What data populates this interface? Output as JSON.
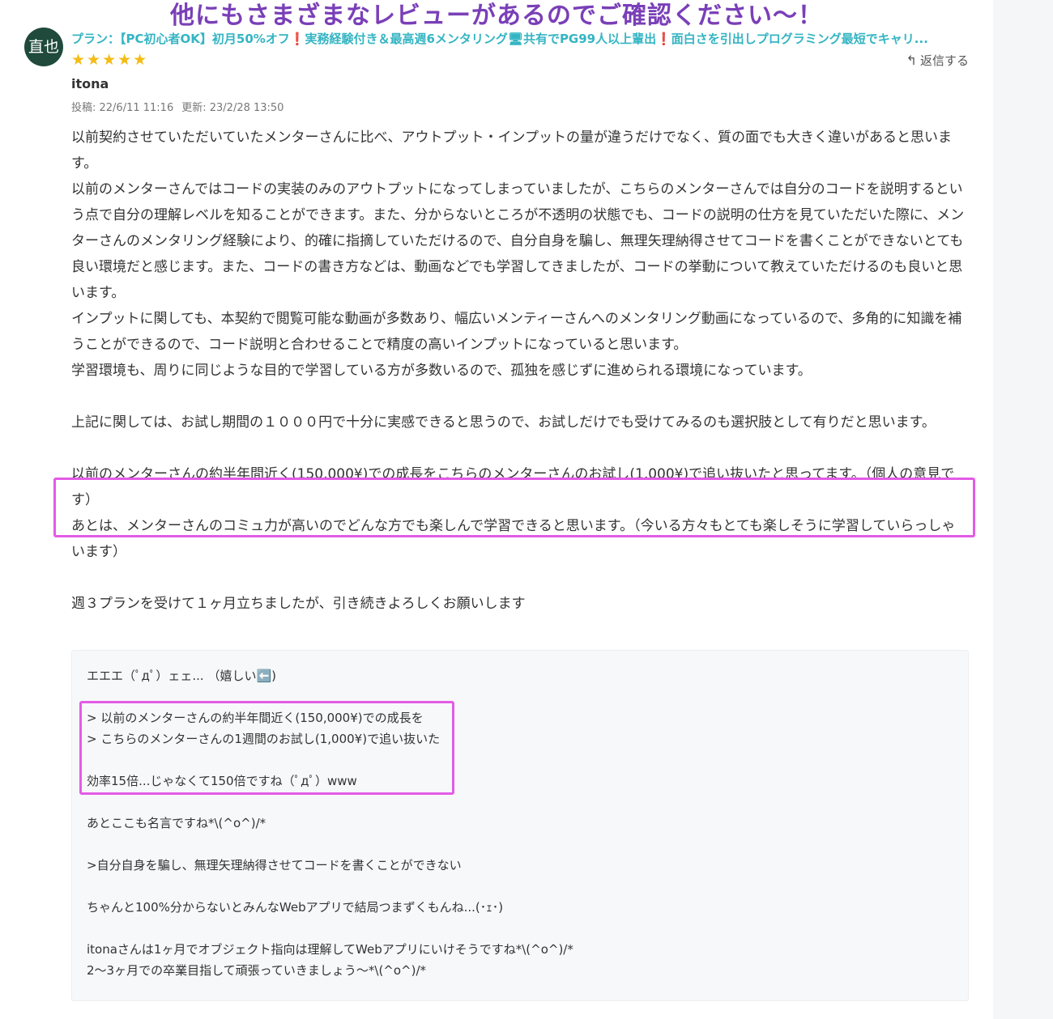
{
  "banner": "他にもさまざまなレビューがあるのでご確認ください〜！",
  "avatar": "直也",
  "plan": "プラン：【PC初心者OK】初月50%オフ❗️実務経験付き＆最高週6メンタリング🖥共有でPG99人以上輩出❗️面白さを引出しプログラミング最短でキャリ...",
  "stars": "★★★★★",
  "reply_label": "返信する",
  "user": "itona",
  "posted": "投稿: 22/6/11 11:16",
  "updated": "更新: 23/2/28 13:50",
  "review": [
    "以前契約させていただいていたメンターさんに比べ、アウトプット・インプットの量が違うだけでなく、質の面でも大きく違いがあると思います。",
    "以前のメンターさんではコードの実装のみのアウトプットになってしまっていましたが、こちらのメンターさんでは自分のコードを説明するという点で自分の理解レベルを知ることができます。また、分からないところが不透明の状態でも、コードの説明の仕方を見ていただいた際に、メンターさんのメンタリング経験により、的確に指摘していただけるので、自分自身を騙し、無理矢理納得させてコードを書くことができないとても良い環境だと感じます。また、コードの書き方などは、動画などでも学習してきましたが、コードの挙動について教えていただけるのも良いと思います。",
    "インプットに関しても、本契約で閲覧可能な動画が多数あり、幅広いメンティーさんへのメンタリング動画になっているので、多角的に知識を補うことができるので、コード説明と合わせることで精度の高いインプットになっていると思います。",
    "学習環境も、周りに同じような目的で学習している方が多数いるので、孤独を感じずに進められる環境になっています。",
    "",
    "上記に関しては、お試し期間の１０００円で十分に実感できると思うので、お試しだけでも受けてみるのも選択肢として有りだと思います。",
    "",
    "以前のメンターさんの約半年間近く(150,000¥)での成長をこちらのメンターさんのお試し(1,000¥)で追い抜いたと思ってます。（個人の意見です）",
    "あとは、メンターさんのコミュ力が高いのでどんな方でも楽しんで学習できると思います。（今いる方々もとても楽しそうに学習していらっしゃいます）",
    "",
    "週３プランを受けて１ヶ月立ちましたが、引き続きよろしくお願いします"
  ],
  "mentor_reply": [
    "エエエ（ﾟдﾟ）ェェ... （嬉しい⬅️)",
    "",
    "> 以前のメンターさんの約半年間近く(150,000¥)での成長を",
    "> こちらのメンターさんの1週間のお試し(1,000¥)で追い抜いた",
    "",
    "効率15倍...じゃなくて150倍ですね（ﾟдﾟ）www",
    "",
    "あとここも名言ですね*\\(^o^)/*",
    "",
    ">自分自身を騙し、無理矢理納得させてコードを書くことができない",
    "",
    "ちゃんと100%分からないとみんなWebアプリで結局つまずくもんね...(･ｪ･)",
    "",
    "itonaさんは1ヶ月でオブジェクト指向は理解してWebアプリにいけそうですね*\\(^o^)/*",
    "2〜3ヶ月での卒業目指して頑張っていきましょう〜*\\(^o^)/*"
  ]
}
